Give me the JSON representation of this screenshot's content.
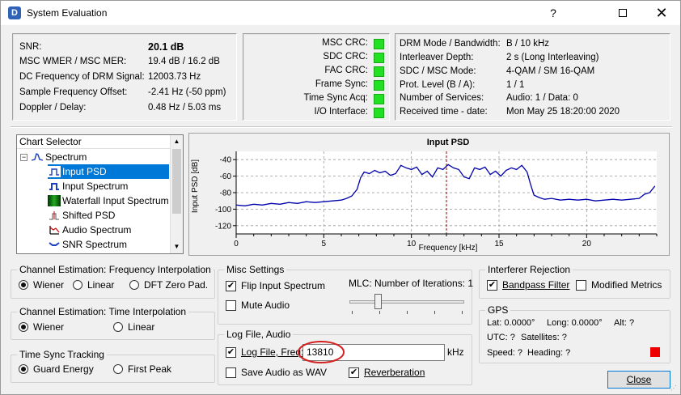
{
  "window": {
    "title": "System Evaluation",
    "icon_letter": "D"
  },
  "status": {
    "labels": [
      "SNR:",
      "MSC WMER / MSC MER:",
      "DC Frequency of DRM Signal:",
      "Sample Frequency Offset:",
      "Doppler / Delay:"
    ],
    "values": [
      "20.1 dB",
      "19.4 dB / 16.2 dB",
      "12003.73 Hz",
      "-2.41 Hz (-50 ppm)",
      "0.48 Hz / 5.03 ms"
    ]
  },
  "crc": {
    "labels": [
      "MSC CRC:",
      "SDC CRC:",
      "FAC CRC:",
      "Frame Sync:",
      "Time Sync Acq:",
      "I/O Interface:"
    ],
    "led_color": "#22e122"
  },
  "drm_info": {
    "labels": [
      "DRM Mode / Bandwidth:",
      "Interleaver Depth:",
      "SDC / MSC Mode:",
      "Prot. Level (B / A):",
      "Number of Services:",
      "Received time - date:"
    ],
    "values": [
      "B / 10 kHz",
      "2 s (Long Interleaving)",
      "4-QAM / SM 16-QAM",
      "1 / 1",
      "Audio: 1 / Data: 0",
      "Mon May 25 18:20:00 2020"
    ]
  },
  "chart_selector": {
    "header": "Chart Selector",
    "root": "Spectrum",
    "items": [
      "Input PSD",
      "Input Spectrum",
      "Waterfall Input Spectrum",
      "Shifted PSD",
      "Audio Spectrum",
      "SNR Spectrum"
    ],
    "selected": 0
  },
  "chart_data": {
    "type": "line",
    "title": "Input PSD",
    "xlabel": "Frequency [kHz]",
    "ylabel": "Input PSD [dB]",
    "xlim": [
      0,
      24
    ],
    "ylim": [
      -130,
      -30
    ],
    "xticks": [
      0,
      5,
      10,
      15,
      20
    ],
    "yticks": [
      -40,
      -60,
      -80,
      -100,
      -120
    ],
    "grid": true,
    "line_color": "#0000aa",
    "marker_x": 12,
    "series": [
      {
        "x": [
          0,
          0.5,
          1,
          1.5,
          2,
          2.5,
          3,
          3.5,
          4,
          4.5,
          5,
          5.5,
          6,
          6.3,
          6.6,
          6.9,
          7.1,
          7.3,
          7.6,
          7.9,
          8.2,
          8.5,
          8.8,
          9.1,
          9.4,
          9.7,
          10,
          10.3,
          10.6,
          10.9,
          11.2,
          11.5,
          11.8,
          12.1,
          12.4,
          12.7,
          13,
          13.3,
          13.6,
          13.9,
          14.2,
          14.5,
          14.8,
          15.1,
          15.4,
          15.7,
          16,
          16.3,
          16.6,
          16.8,
          17,
          17.3,
          17.6,
          18,
          18.5,
          19,
          19.5,
          20,
          20.5,
          21,
          21.5,
          22,
          22.5,
          23,
          23.3,
          23.6,
          23.9
        ],
        "y": [
          -95,
          -96,
          -94,
          -95,
          -93,
          -94,
          -92,
          -93,
          -91,
          -92,
          -91,
          -90,
          -89,
          -87,
          -84,
          -76,
          -62,
          -55,
          -57,
          -53,
          -56,
          -54,
          -59,
          -57,
          -47,
          -50,
          -52,
          -49,
          -58,
          -54,
          -61,
          -50,
          -52,
          -46,
          -50,
          -52,
          -61,
          -63,
          -50,
          -52,
          -49,
          -58,
          -54,
          -60,
          -53,
          -50,
          -52,
          -47,
          -55,
          -70,
          -83,
          -86,
          -88,
          -87,
          -89,
          -88,
          -89,
          -88,
          -90,
          -89,
          -88,
          -89,
          -88,
          -87,
          -82,
          -80,
          -72
        ]
      }
    ]
  },
  "freq_interp": {
    "title": "Channel Estimation: Frequency Interpolation",
    "options": [
      "Wiener",
      "Linear",
      "DFT Zero Pad."
    ],
    "selected": 0
  },
  "time_interp": {
    "title": "Channel Estimation: Time Interpolation",
    "options": [
      "Wiener",
      "Linear"
    ],
    "selected": 0
  },
  "time_sync": {
    "title": "Time Sync Tracking",
    "options": [
      "Guard Energy",
      "First Peak"
    ],
    "selected": 0
  },
  "misc": {
    "title": "Misc Settings",
    "flip_label": "Flip Input Spectrum",
    "flip_checked": true,
    "mute_label": "Mute Audio",
    "mute_checked": false,
    "mlc_label": "MLC: Number of Iterations: 1",
    "mlc_value": 1,
    "mlc_max": 4
  },
  "log": {
    "title": "Log File, Audio",
    "log_label": "Log File, Freq:",
    "log_checked": true,
    "freq_value": "13810",
    "freq_unit": "kHz",
    "save_label": "Save Audio as WAV",
    "save_checked": false,
    "reverb_label": "Reverberation",
    "reverb_checked": true
  },
  "interferer": {
    "title": "Interferer Rejection",
    "bandpass_label": "Bandpass Filter",
    "bandpass_checked": true,
    "modified_label": "Modified Metrics",
    "modified_checked": false
  },
  "gps": {
    "title": "GPS",
    "lat": "Lat: 0.0000°",
    "long": "Long: 0.0000°",
    "alt": "Alt: ?",
    "utc": "UTC: ?",
    "satellites": "Satellites: ?",
    "speed": "Speed: ?",
    "heading": "Heading: ?",
    "status_color": "#ee0000"
  },
  "close_label": "Close",
  "annotation_color": "#d42020"
}
